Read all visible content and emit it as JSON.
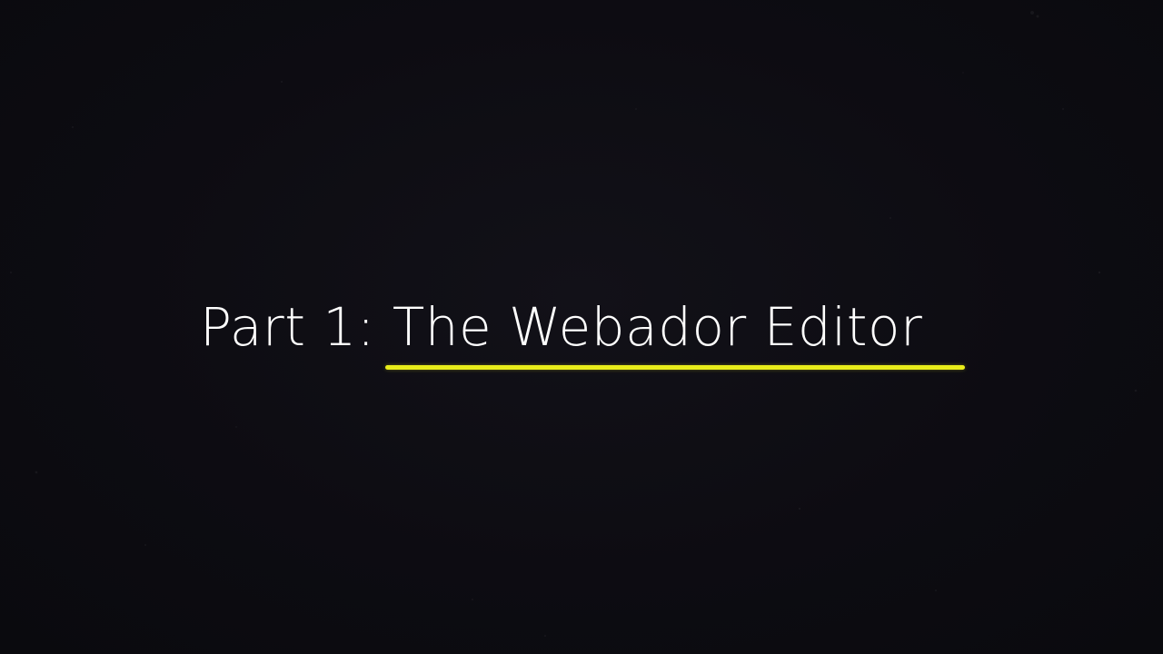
{
  "slide": {
    "title_prefix": "Part 1:",
    "title_main": "The Webador Editor"
  },
  "colors": {
    "background": "#0d0c12",
    "text": "#ffffff",
    "underline_accent": "#e8ec1a"
  }
}
